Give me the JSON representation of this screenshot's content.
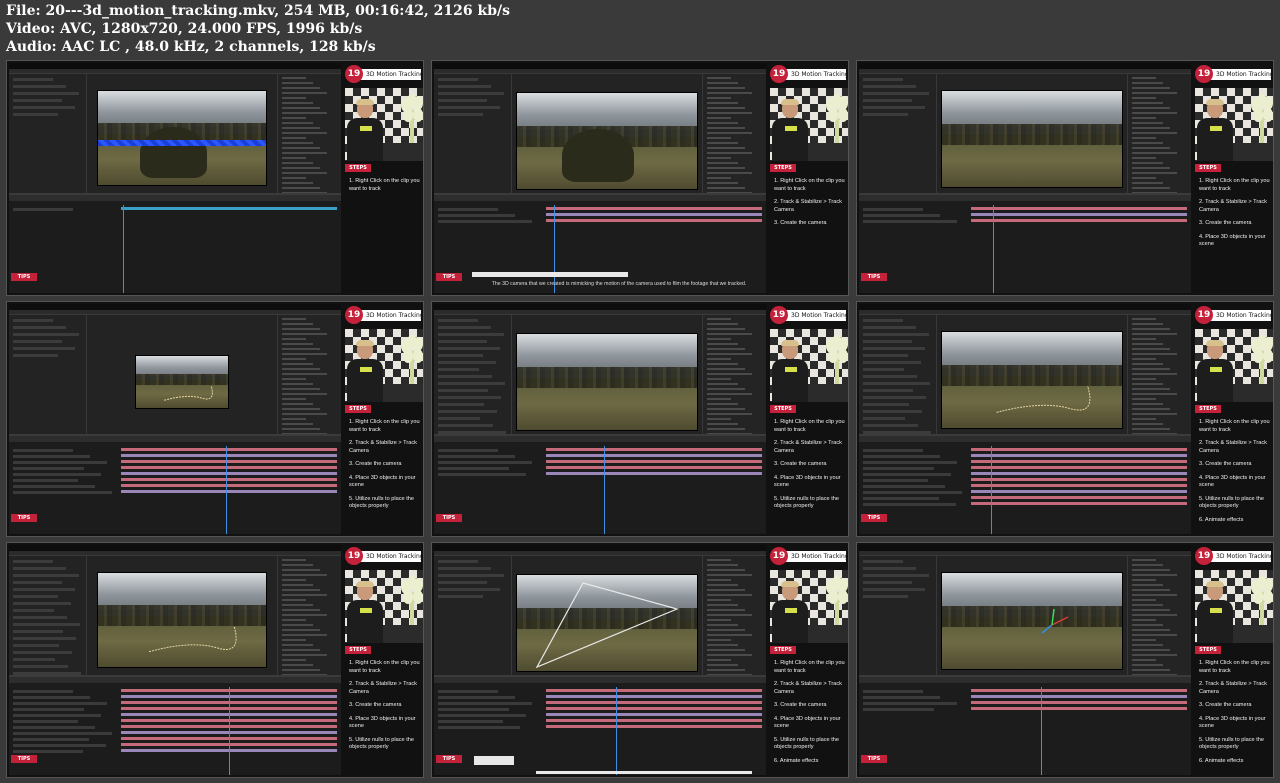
{
  "header": {
    "file_line": "File: 20---3d_motion_tracking.mkv, 254 MB, 00:16:42, 2126 kb/s",
    "video_line": "Video: AVC, 1280x720, 24.000 FPS, 1996 kb/s",
    "audio_line": "Audio: AAC LC , 48.0 kHz, 2 channels, 128 kb/s"
  },
  "overlay": {
    "lesson_number": "19",
    "course_title": "3D Motion Tracking",
    "steps_label": "STEPS",
    "tips_label": "TIPS"
  },
  "steps": [
    "1. Right Click on the clip you want to track",
    "2. Track & Stabilize > Track Camera",
    "3. Create the camera",
    "4. Place 3D objects in your scene",
    "5. Utilize nulls to place the objects properly",
    "6. Animate effects"
  ],
  "thumbnails": [
    {
      "steps_shown": 1,
      "subtitle": ""
    },
    {
      "steps_shown": 3,
      "subtitle": "The 3D camera that we created is mimicking the motion of the camera used to film the footage that we tracked."
    },
    {
      "steps_shown": 4,
      "subtitle": ""
    },
    {
      "steps_shown": 5,
      "subtitle": ""
    },
    {
      "steps_shown": 5,
      "subtitle": ""
    },
    {
      "steps_shown": 6,
      "subtitle": ""
    },
    {
      "steps_shown": 5,
      "subtitle": ""
    },
    {
      "steps_shown": 6,
      "subtitle": ""
    },
    {
      "steps_shown": 6,
      "subtitle": ""
    }
  ],
  "colors": {
    "accent_red": "#c4213a",
    "ae_panel": "#232323",
    "playhead_blue": "#3c8ee6",
    "layer_bar_pink": "#c46a7a",
    "layer_bar_lilac": "#9a86b8",
    "tracking_band_blue": "#2a57ff"
  },
  "icons": [
    "lesson-badge-icon",
    "palm-tree-decoration-icon"
  ]
}
